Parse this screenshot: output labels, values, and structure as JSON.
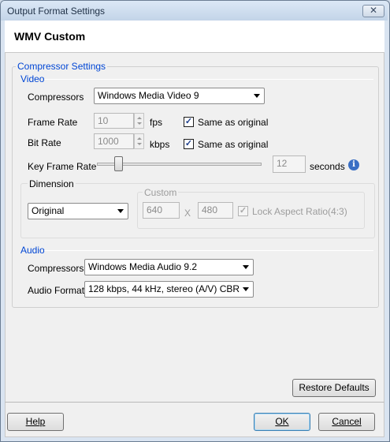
{
  "window": {
    "title": "Output Format Settings",
    "close_glyph": "✕"
  },
  "header": {
    "title": "WMV Custom"
  },
  "compressor_settings": {
    "legend": "Compressor Settings",
    "video": {
      "legend": "Video",
      "compressors_label": "Compressors",
      "compressors_value": "Windows Media Video 9",
      "frame_rate_label": "Frame Rate",
      "frame_rate_value": "10",
      "frame_rate_unit": "fps",
      "frame_rate_same": "Same as original",
      "frame_rate_same_checked": true,
      "bit_rate_label": "Bit Rate",
      "bit_rate_value": "1000",
      "bit_rate_unit": "kbps",
      "bit_rate_same": "Same as original",
      "bit_rate_same_checked": true,
      "key_frame_label": "Key Frame Rate",
      "key_frame_value": "12",
      "key_frame_unit": "seconds",
      "key_frame_slider_fraction": 0.11,
      "dimension": {
        "legend": "Dimension",
        "value": "Original",
        "custom_legend": "Custom",
        "width": "640",
        "x": "X",
        "height": "480",
        "lock_label": "Lock Aspect Ratio(4:3)",
        "lock_checked": true
      }
    },
    "audio": {
      "legend": "Audio",
      "compressors_label": "Compressors",
      "compressors_value": "Windows Media Audio 9.2",
      "formats_label": "Audio Formats",
      "formats_value": "128 kbps, 44 kHz, stereo (A/V) CBR"
    }
  },
  "buttons": {
    "restore": "Restore Defaults",
    "help": "Help",
    "ok": "OK",
    "cancel": "Cancel"
  },
  "colors": {
    "legend": "#0046d5",
    "info_icon": "#3a6fc4"
  },
  "icons": {
    "info": "info-icon",
    "check": "✓"
  }
}
